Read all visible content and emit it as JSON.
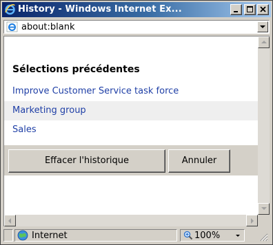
{
  "window": {
    "title": "History - Windows Internet Ex..."
  },
  "address": {
    "url": "about:blank"
  },
  "content": {
    "heading": "Sélections précédentes",
    "items": [
      "Improve Customer Service task force",
      "Marketing group",
      "Sales"
    ],
    "clear_button": "Effacer l'historique",
    "cancel_button": "Annuler"
  },
  "status": {
    "zone": "Internet",
    "zoom": "100%"
  },
  "icons": {
    "title": "ie-logo-icon",
    "address": "ie-page-icon",
    "zone": "globe-icon",
    "zoom": "magnifier-icon"
  },
  "colors": {
    "titlebar_start": "#0a246a",
    "titlebar_end": "#a6caf0",
    "link": "#1f3fa6",
    "chrome": "#d4d0c8"
  }
}
